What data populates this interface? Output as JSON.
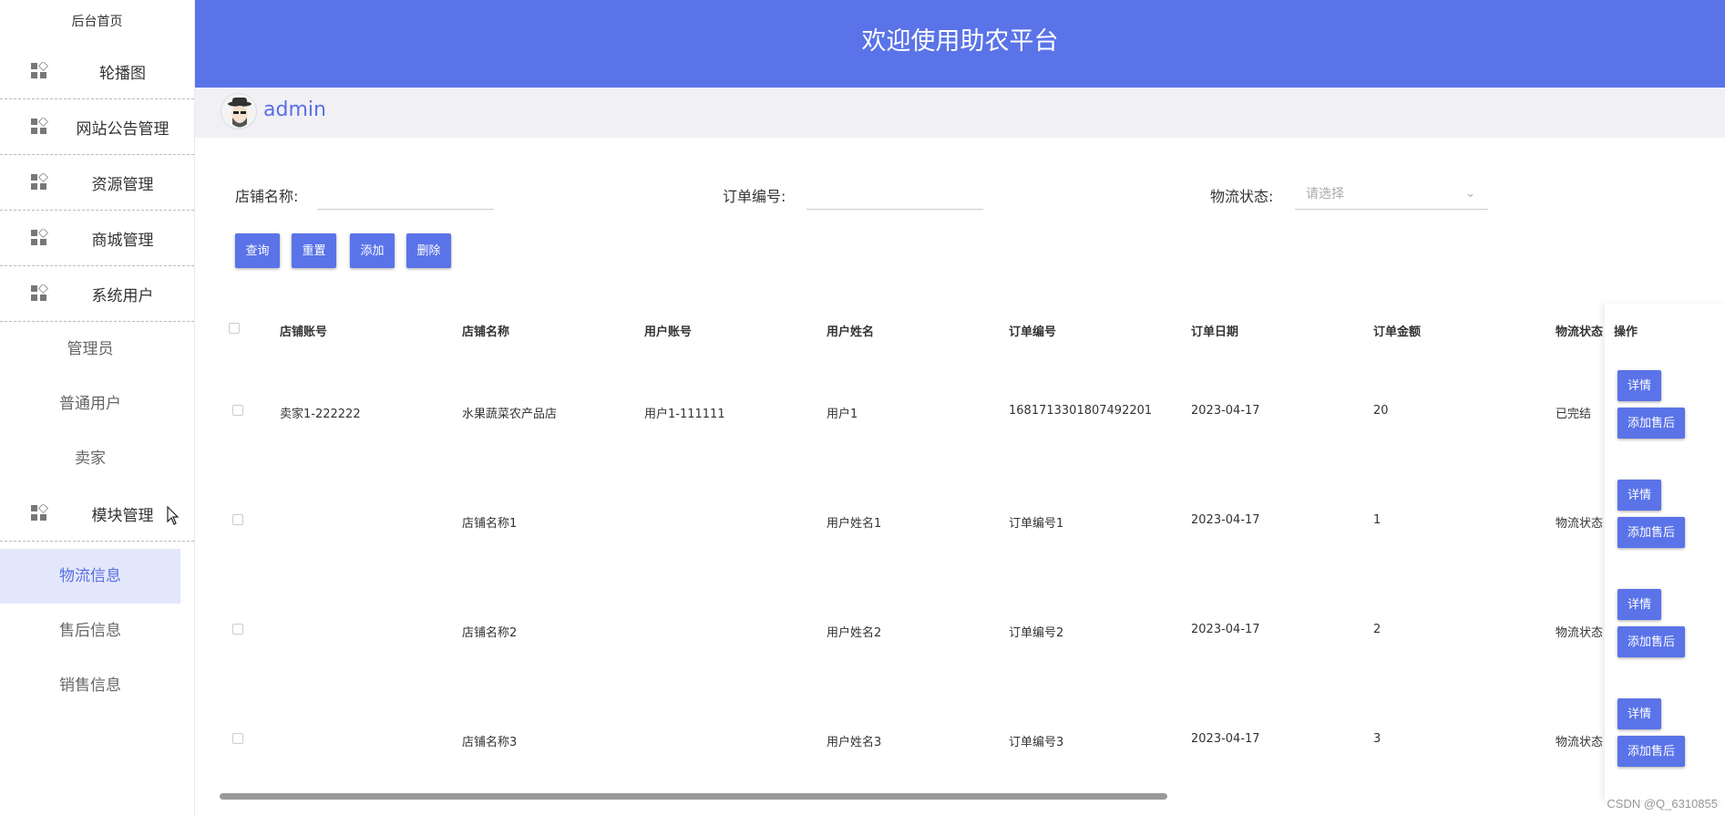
{
  "app": {
    "title": "欢迎使用助农平台",
    "user": "admin",
    "watermark": "CSDN @Q_6310855"
  },
  "sidebar": {
    "home": "后台首页",
    "groups": [
      {
        "label": "轮播图"
      },
      {
        "label": "网站公告管理"
      },
      {
        "label": "资源管理"
      },
      {
        "label": "商城管理"
      },
      {
        "label": "系统用户"
      }
    ],
    "users_sub": [
      "管理员",
      "普通用户",
      "卖家"
    ],
    "module_group": "模块管理",
    "module_sub": [
      "物流信息",
      "售后信息",
      "销售信息"
    ],
    "active": "物流信息"
  },
  "filters": {
    "shop_name_label": "店铺名称:",
    "order_no_label": "订单编号:",
    "logistics_label": "物流状态:",
    "logistics_placeholder": "请选择"
  },
  "buttons": {
    "query": "查询",
    "reset": "重置",
    "add": "添加",
    "delete": "删除"
  },
  "table": {
    "headers": [
      "店铺账号",
      "店铺名称",
      "用户账号",
      "用户姓名",
      "订单编号",
      "订单日期",
      "订单金额",
      "物流状态",
      "操作"
    ],
    "rows": [
      [
        "卖家1-222222",
        "水果蔬菜农产品店",
        "用户1-111111",
        "用户1",
        "1681713301807492201",
        "2023-04-17",
        "20",
        "已完结"
      ],
      [
        "",
        "店铺名称1",
        "",
        "用户姓名1",
        "订单编号1",
        "2023-04-17",
        "1",
        "物流状态"
      ],
      [
        "",
        "店铺名称2",
        "",
        "用户姓名2",
        "订单编号2",
        "2023-04-17",
        "2",
        "物流状态"
      ],
      [
        "",
        "店铺名称3",
        "",
        "用户姓名3",
        "订单编号3",
        "2023-04-17",
        "3",
        "物流状态"
      ]
    ],
    "row_actions": {
      "detail": "详情",
      "after_sale": "添加售后"
    }
  }
}
